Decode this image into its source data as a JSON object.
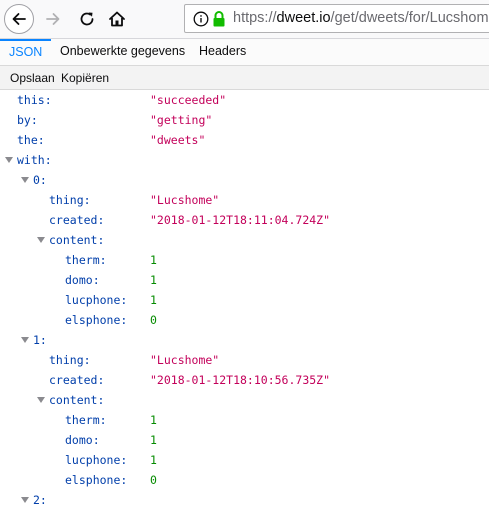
{
  "browser": {
    "url_scheme": "https://",
    "url_host": "dweet.io",
    "url_path": "/get/dweets/for/Lucshome"
  },
  "tabs": [
    {
      "label": "JSON",
      "selected": true
    },
    {
      "label": "Onbewerkte gegevens",
      "selected": false
    },
    {
      "label": "Headers",
      "selected": false
    }
  ],
  "actions": {
    "save_label": "Opslaan",
    "copy_label": "Kopiëren"
  },
  "json": {
    "this_key": "this:",
    "this_val": "\"succeeded\"",
    "by_key": "by:",
    "by_val": "\"getting\"",
    "the_key": "the:",
    "the_val": "\"dweets\"",
    "with_key": "with:",
    "items": [
      {
        "index_key": "0:",
        "thing_key": "thing:",
        "thing_val": "\"Lucshome\"",
        "created_key": "created:",
        "created_val": "\"2018-01-12T18:11:04.724Z\"",
        "content_key": "content:",
        "therm_key": "therm:",
        "therm_val": "1",
        "domo_key": "domo:",
        "domo_val": "1",
        "lucphone_key": "lucphone:",
        "lucphone_val": "1",
        "elsphone_key": "elsphone:",
        "elsphone_val": "0"
      },
      {
        "index_key": "1:",
        "thing_key": "thing:",
        "thing_val": "\"Lucshome\"",
        "created_key": "created:",
        "created_val": "\"2018-01-12T18:10:56.735Z\"",
        "content_key": "content:",
        "therm_key": "therm:",
        "therm_val": "1",
        "domo_key": "domo:",
        "domo_val": "1",
        "lucphone_key": "lucphone:",
        "lucphone_val": "1",
        "elsphone_key": "elsphone:",
        "elsphone_val": "0"
      }
    ],
    "next_index_key": "2:"
  },
  "colors": {
    "key": "#003eaa",
    "string": "#c3005a",
    "number": "#058b00",
    "tab_accent": "#0a84ff",
    "lock": "#12bc00"
  }
}
